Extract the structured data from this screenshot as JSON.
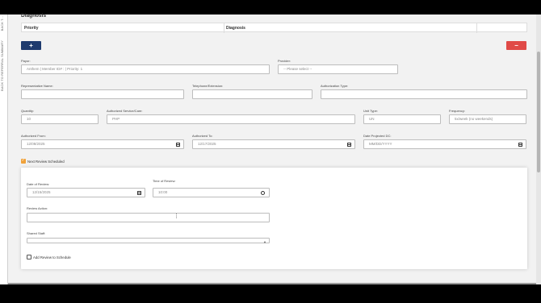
{
  "sidebar": {
    "back_to_top": "BACK T...",
    "back_to_referral": "BACK TO REFERRAL SUMMARY"
  },
  "diagnosis": {
    "heading": "Diagnosis",
    "columns": [
      "Priority",
      "Diagnosis"
    ]
  },
  "buttons": {
    "add": "+",
    "remove": "−"
  },
  "form": {
    "payor": {
      "label": "Payor:",
      "value": "Anthem | Member ID# : | Priority: 1"
    },
    "provider": {
      "label": "Provider:",
      "value": "-- Please select --"
    },
    "rep_name": {
      "label": "Representative Name:",
      "value": ""
    },
    "telephone": {
      "label": "Telephone/Extension:",
      "value": ""
    },
    "auth_type": {
      "label": "Authorization Type:",
      "value": ""
    },
    "quantity": {
      "label": "Quantity:",
      "value": "10"
    },
    "auth_service": {
      "label": "Authorized Service/Care:",
      "value": "PHP"
    },
    "unit_type": {
      "label": "Unit Type:",
      "value": "UN"
    },
    "frequency": {
      "label": "Frequency:",
      "value": "5x/week (no weekends)"
    },
    "auth_from": {
      "label": "Authorized From:",
      "value": "12/08/2025"
    },
    "auth_to": {
      "label": "Authorized To:",
      "value": "12/17/2025"
    },
    "projected_dc": {
      "label": "Date Projected DC:",
      "value": "MM/DD/YYYY"
    },
    "next_review": {
      "label": "Next Review Scheduled",
      "checked": true
    }
  },
  "review": {
    "date": {
      "label": "Date of Review:",
      "value": "12/15/2025"
    },
    "time": {
      "label": "Time of Review:",
      "value": "10:00"
    },
    "action": {
      "label": "Review Action:",
      "value": ""
    },
    "shared_staff": {
      "label": "Shared Staff:",
      "value": ""
    },
    "add_to_schedule": {
      "label": "Add Review to Schedule",
      "checked": false
    }
  },
  "colors": {
    "primary": "#1e3a6e",
    "danger": "#e04a47",
    "checkbox": "#f0a23a"
  }
}
